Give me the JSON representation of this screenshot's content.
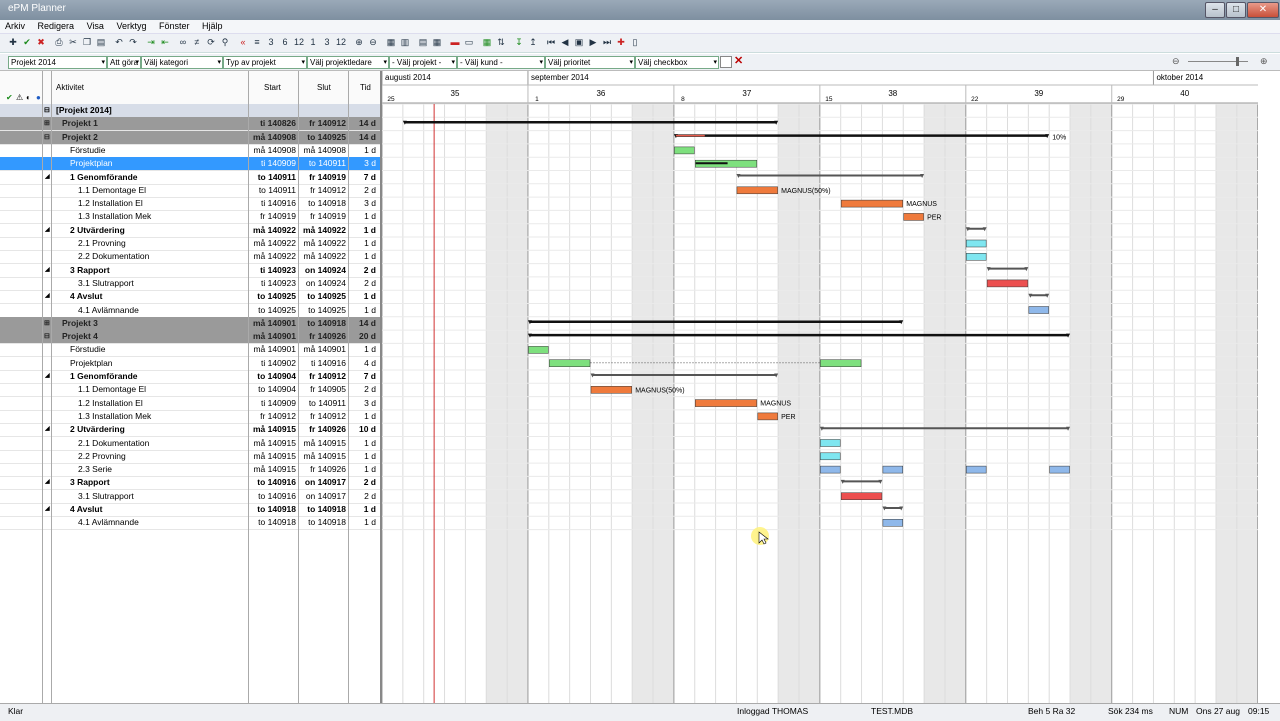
{
  "window": {
    "title": "ePM Planner"
  },
  "menu": [
    "Arkiv",
    "Redigera",
    "Visa",
    "Verktyg",
    "Fönster",
    "Hjälp"
  ],
  "filters": [
    "Projekt 2014",
    "Att göra",
    "Välj kategori",
    "Typ av projekt",
    "Välj projektledare",
    "- Välj projekt -",
    "- Välj kund -",
    "Välj prioritet",
    "Välj checkbox"
  ],
  "toolbar_numbers": [
    "3",
    "6",
    "12",
    "1",
    "3",
    "12"
  ],
  "grid_headers": {
    "activity": "Aktivitet",
    "start": "Start",
    "end": "Slut",
    "time": "Tid"
  },
  "timeline": {
    "months": [
      {
        "label": "augusti 2014"
      },
      {
        "label": "september 2014"
      },
      {
        "label": "oktober 2014"
      }
    ],
    "weeks": [
      "35",
      "36",
      "37",
      "38",
      "39",
      "40"
    ],
    "days": [
      "25",
      "1",
      "8",
      "15",
      "22",
      "29"
    ]
  },
  "rows": [
    {
      "name": "[Projekt 2014]",
      "start": "",
      "end": "",
      "dur": "",
      "kind": "top"
    },
    {
      "name": "Projekt 1",
      "start": "ti 140826",
      "end": "fr 140912",
      "dur": "14 d",
      "kind": "proj"
    },
    {
      "name": "Projekt 2",
      "start": "må 140908",
      "end": "to 140925",
      "dur": "14 d",
      "kind": "proj"
    },
    {
      "name": "Förstudie",
      "start": "må 140908",
      "end": "må 140908",
      "dur": "1 d",
      "kind": "task"
    },
    {
      "name": "Projektplan",
      "start": "ti 140909",
      "end": "to 140911",
      "dur": "3 d",
      "kind": "sel"
    },
    {
      "name": "1  Genomförande",
      "start": "to 140911",
      "end": "fr 140919",
      "dur": "7 d",
      "kind": "bold"
    },
    {
      "name": "1.1  Demontage El",
      "start": "to 140911",
      "end": "fr 140912",
      "dur": "2 d",
      "kind": "task"
    },
    {
      "name": "1.2  Installation El",
      "start": "ti 140916",
      "end": "to 140918",
      "dur": "3 d",
      "kind": "task"
    },
    {
      "name": "1.3  Installation Mek",
      "start": "fr 140919",
      "end": "fr 140919",
      "dur": "1 d",
      "kind": "task"
    },
    {
      "name": "2  Utvärdering",
      "start": "må 140922",
      "end": "må 140922",
      "dur": "1 d",
      "kind": "bold"
    },
    {
      "name": "2.1  Provning",
      "start": "må 140922",
      "end": "må 140922",
      "dur": "1 d",
      "kind": "task"
    },
    {
      "name": "2.2  Dokumentation",
      "start": "må 140922",
      "end": "må 140922",
      "dur": "1 d",
      "kind": "task"
    },
    {
      "name": "3  Rapport",
      "start": "ti 140923",
      "end": "on 140924",
      "dur": "2 d",
      "kind": "bold"
    },
    {
      "name": "3.1  Slutrapport",
      "start": "ti 140923",
      "end": "on 140924",
      "dur": "2 d",
      "kind": "task"
    },
    {
      "name": "4  Avslut",
      "start": "to 140925",
      "end": "to 140925",
      "dur": "1 d",
      "kind": "bold"
    },
    {
      "name": "4.1  Avlämnande",
      "start": "to 140925",
      "end": "to 140925",
      "dur": "1 d",
      "kind": "task"
    },
    {
      "name": "Projekt 3",
      "start": "må 140901",
      "end": "to 140918",
      "dur": "14 d",
      "kind": "proj"
    },
    {
      "name": "Projekt 4",
      "start": "må 140901",
      "end": "fr 140926",
      "dur": "20 d",
      "kind": "proj"
    },
    {
      "name": "Förstudie",
      "start": "må 140901",
      "end": "må 140901",
      "dur": "1 d",
      "kind": "task"
    },
    {
      "name": "Projektplan",
      "start": "ti 140902",
      "end": "ti 140916",
      "dur": "4 d",
      "kind": "task"
    },
    {
      "name": "1  Genomförande",
      "start": "to 140904",
      "end": "fr 140912",
      "dur": "7 d",
      "kind": "bold"
    },
    {
      "name": "1.1  Demontage El",
      "start": "to 140904",
      "end": "fr 140905",
      "dur": "2 d",
      "kind": "task"
    },
    {
      "name": "1.2  Installation El",
      "start": "ti 140909",
      "end": "to 140911",
      "dur": "3 d",
      "kind": "task"
    },
    {
      "name": "1.3  Installation Mek",
      "start": "fr 140912",
      "end": "fr 140912",
      "dur": "1 d",
      "kind": "task"
    },
    {
      "name": "2  Utvärdering",
      "start": "må 140915",
      "end": "fr 140926",
      "dur": "10 d",
      "kind": "bold"
    },
    {
      "name": "2.1  Dokumentation",
      "start": "må 140915",
      "end": "må 140915",
      "dur": "1 d",
      "kind": "task"
    },
    {
      "name": "2.2  Provning",
      "start": "må 140915",
      "end": "må 140915",
      "dur": "1 d",
      "kind": "task"
    },
    {
      "name": "2.3  Serie",
      "start": "må 140915",
      "end": "fr 140926",
      "dur": "1 d",
      "kind": "task"
    },
    {
      "name": "3  Rapport",
      "start": "to 140916",
      "end": "on 140917",
      "dur": "2 d",
      "kind": "bold"
    },
    {
      "name": "3.1  Slutrapport",
      "start": "to 140916",
      "end": "on 140917",
      "dur": "2 d",
      "kind": "task"
    },
    {
      "name": "4  Avslut",
      "start": "to 140918",
      "end": "to 140918",
      "dur": "1 d",
      "kind": "bold"
    },
    {
      "name": "4.1  Avlämnande",
      "start": "to 140918",
      "end": "to 140918",
      "dur": "1 d",
      "kind": "task"
    }
  ],
  "bars": [
    {
      "row": 1,
      "s": "2014-08-26",
      "e": "2014-09-12",
      "t": "summary"
    },
    {
      "row": 2,
      "s": "2014-09-08",
      "e": "2014-09-25",
      "t": "summary",
      "label": "10%"
    },
    {
      "row": 3,
      "s": "2014-09-08",
      "e": "2014-09-08",
      "t": "green"
    },
    {
      "row": 4,
      "s": "2014-09-09",
      "e": "2014-09-11",
      "t": "green"
    },
    {
      "row": 5,
      "s": "2014-09-11",
      "e": "2014-09-19",
      "t": "group"
    },
    {
      "row": 6,
      "s": "2014-09-11",
      "e": "2014-09-12",
      "t": "orange",
      "label": "MAGNUS(50%)"
    },
    {
      "row": 7,
      "s": "2014-09-16",
      "e": "2014-09-18",
      "t": "orange",
      "label": "MAGNUS"
    },
    {
      "row": 8,
      "s": "2014-09-19",
      "e": "2014-09-19",
      "t": "orange",
      "label": "PER"
    },
    {
      "row": 9,
      "s": "2014-09-22",
      "e": "2014-09-22",
      "t": "group"
    },
    {
      "row": 10,
      "s": "2014-09-22",
      "e": "2014-09-22",
      "t": "cyan"
    },
    {
      "row": 11,
      "s": "2014-09-22",
      "e": "2014-09-22",
      "t": "cyan"
    },
    {
      "row": 12,
      "s": "2014-09-23",
      "e": "2014-09-24",
      "t": "group"
    },
    {
      "row": 13,
      "s": "2014-09-23",
      "e": "2014-09-24",
      "t": "red"
    },
    {
      "row": 14,
      "s": "2014-09-25",
      "e": "2014-09-25",
      "t": "group"
    },
    {
      "row": 15,
      "s": "2014-09-25",
      "e": "2014-09-25",
      "t": "blue"
    },
    {
      "row": 16,
      "s": "2014-09-01",
      "e": "2014-09-18",
      "t": "summary"
    },
    {
      "row": 17,
      "s": "2014-09-01",
      "e": "2014-09-26",
      "t": "summary"
    },
    {
      "row": 18,
      "s": "2014-09-01",
      "e": "2014-09-01",
      "t": "green"
    },
    {
      "row": 19,
      "s": "2014-09-02",
      "e": "2014-09-03",
      "t": "green"
    },
    {
      "row": 19,
      "s": "2014-09-15",
      "e": "2014-09-16",
      "t": "green"
    },
    {
      "row": 20,
      "s": "2014-09-04",
      "e": "2014-09-12",
      "t": "group"
    },
    {
      "row": 21,
      "s": "2014-09-04",
      "e": "2014-09-05",
      "t": "orange",
      "label": "MAGNUS(50%)"
    },
    {
      "row": 22,
      "s": "2014-09-09",
      "e": "2014-09-11",
      "t": "orange",
      "label": "MAGNUS"
    },
    {
      "row": 23,
      "s": "2014-09-12",
      "e": "2014-09-12",
      "t": "orange",
      "label": "PER"
    },
    {
      "row": 24,
      "s": "2014-09-15",
      "e": "2014-09-26",
      "t": "group"
    },
    {
      "row": 25,
      "s": "2014-09-15",
      "e": "2014-09-15",
      "t": "cyan"
    },
    {
      "row": 26,
      "s": "2014-09-15",
      "e": "2014-09-15",
      "t": "cyan"
    },
    {
      "row": 27,
      "s": "2014-09-15",
      "e": "2014-09-15",
      "t": "blue"
    },
    {
      "row": 27,
      "s": "2014-09-18",
      "e": "2014-09-18",
      "t": "blue"
    },
    {
      "row": 27,
      "s": "2014-09-22",
      "e": "2014-09-22",
      "t": "blue"
    },
    {
      "row": 27,
      "s": "2014-09-26",
      "e": "2014-09-26",
      "t": "blue"
    },
    {
      "row": 28,
      "s": "2014-09-16",
      "e": "2014-09-17",
      "t": "group"
    },
    {
      "row": 29,
      "s": "2014-09-16",
      "e": "2014-09-17",
      "t": "red"
    },
    {
      "row": 30,
      "s": "2014-09-18",
      "e": "2014-09-18",
      "t": "group"
    },
    {
      "row": 31,
      "s": "2014-09-18",
      "e": "2014-09-18",
      "t": "blue"
    }
  ],
  "today": "2014-08-27",
  "colors": {
    "green": "#7ee07e",
    "orange": "#ef7a3c",
    "cyan": "#7fe6f0",
    "blue": "#8fb8ea",
    "red": "#ec4f4f",
    "weekend": "#e8e8e8",
    "selection": "#3399ff"
  },
  "status": {
    "ready": "Klar",
    "user": "Inloggad THOMAS",
    "db": "TEST.MDB",
    "pos": "Beh 5  Ra 32",
    "search": "Sök 234 ms",
    "num": "NUM",
    "date": "Ons 27 aug",
    "time": "09:15"
  }
}
